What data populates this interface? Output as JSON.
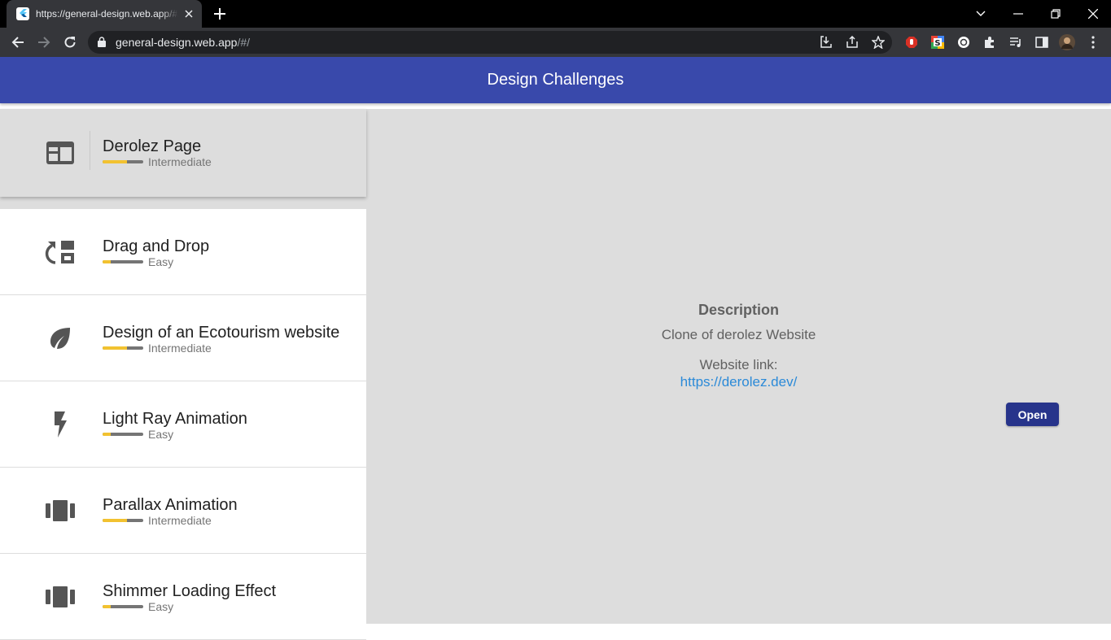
{
  "browser": {
    "tab_title": "https://general-design.web.app/#/",
    "url_host": "general-design.web.app",
    "url_path": "/#/"
  },
  "app": {
    "title": "Design Challenges"
  },
  "challenges": [
    {
      "title": "Derolez Page",
      "level": "Intermediate",
      "progress": 0.6,
      "icon": "web-layout-icon",
      "selected": true
    },
    {
      "title": "Drag and Drop",
      "level": "Easy",
      "progress": 0.2,
      "icon": "drag-drop-icon"
    },
    {
      "title": "Design of an Ecotourism website",
      "level": "Intermediate",
      "progress": 0.6,
      "icon": "leaf-icon"
    },
    {
      "title": "Light Ray Animation",
      "level": "Easy",
      "progress": 0.2,
      "icon": "flash-icon"
    },
    {
      "title": "Parallax Animation",
      "level": "Intermediate",
      "progress": 0.6,
      "icon": "view-carousel-icon"
    },
    {
      "title": "Shimmer Loading Effect",
      "level": "Easy",
      "progress": 0.2,
      "icon": "view-carousel-icon"
    }
  ],
  "detail": {
    "heading": "Description",
    "text": "Clone of derolez Website",
    "link_label": "Website link:",
    "link": "https://derolez.dev/",
    "open_label": "Open"
  },
  "colors": {
    "appbar": "#3949ab",
    "progress_fill": "#f2c230",
    "progress_track": "#757575",
    "button": "#27348b",
    "link": "#2b8ad8"
  }
}
